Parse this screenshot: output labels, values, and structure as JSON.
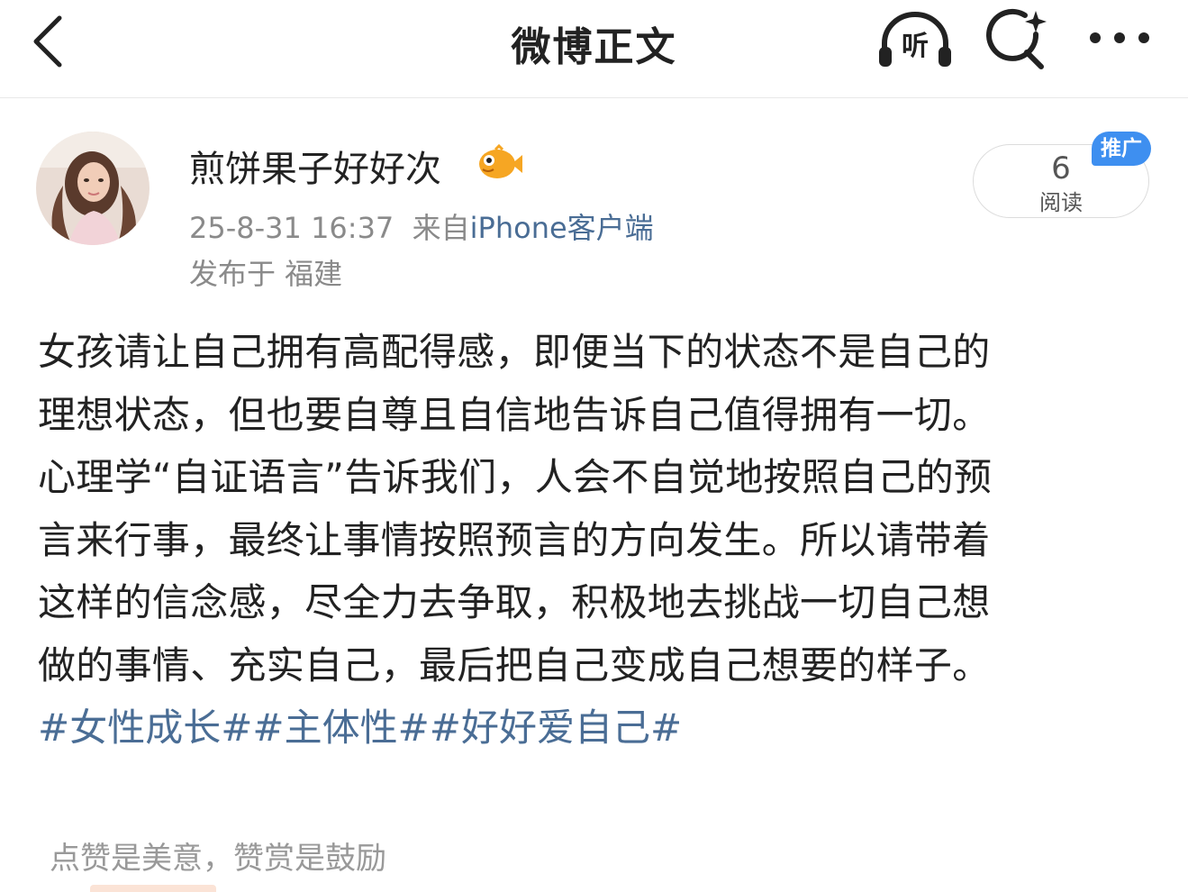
{
  "nav": {
    "title": "微博正文",
    "listen_label": "听"
  },
  "post": {
    "username": "煎饼果子好好次",
    "date": "25-8-31 16:37",
    "source_prefix": "来自",
    "source": "iPhone客户端",
    "location": "发布于 福建",
    "read_count": "6",
    "read_label": "阅读",
    "promo_tag": "推广",
    "lines": [
      "女孩请让自己拥有高配得感，即便当下的状态不是自己的",
      "理想状态，但也要自尊且自信地告诉自己值得拥有一切。",
      "心理学“自证语言”告诉我们，人会不自觉地按照自己的预",
      "言来行事，最终让事情按照预言的方向发生。所以请带着",
      "这样的信念感，尽全力去争取，积极地去挑战一切自己想",
      "做的事情、充实自己，最后把自己变成自己想要的样子。"
    ],
    "tags": [
      "#女性成长#",
      "#主体性#",
      "#好好爱自己#"
    ]
  },
  "footer": {
    "reward_hint": "点赞是美意，赞赏是鼓励"
  },
  "colors": {
    "link": "#4a6d95",
    "meta": "#8a8a8a",
    "promo": "#3e8ff0"
  },
  "icons": [
    "back-arrow-icon",
    "headphones-icon",
    "search-sparkle-icon",
    "more-dots-icon",
    "fish-badge-icon"
  ]
}
